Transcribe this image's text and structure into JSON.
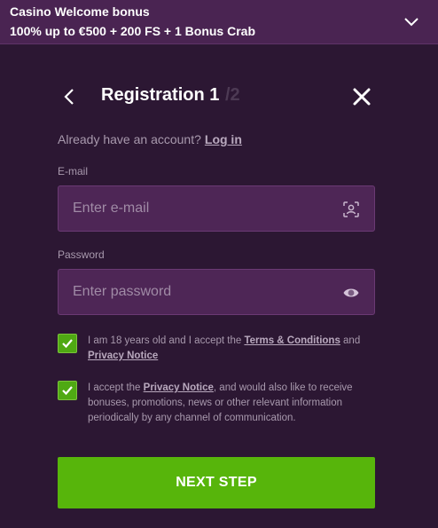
{
  "banner": {
    "title": "Casino Welcome bonus",
    "offer": "100% up to €500 + 200 FS + 1 Bonus Crab"
  },
  "header": {
    "title": "Registration 1",
    "step_total": "/2"
  },
  "account": {
    "prompt": "Already have an account?",
    "login_label": "Log in"
  },
  "email": {
    "label": "E-mail",
    "placeholder": "Enter e-mail",
    "value": ""
  },
  "password": {
    "label": "Password",
    "placeholder": "Enter password",
    "value": ""
  },
  "consent_terms": {
    "checked": true,
    "text_before": "I am 18 years old and I accept the ",
    "terms_link": "Terms & Conditions",
    "text_and": " and ",
    "privacy_link": "Privacy Notice"
  },
  "consent_marketing": {
    "checked": true,
    "text_before": "I accept the ",
    "privacy_link": "Privacy Notice",
    "text_after": ", and would also like to receive bonuses, promotions, news or other relevant information periodically by any channel of communication."
  },
  "next_button": {
    "label": "NEXT STEP"
  },
  "icons": {
    "banner_toggle": "chevron-down-icon",
    "back": "chevron-left-icon",
    "close": "close-icon",
    "email_field": "face-scan-icon",
    "password_field": "eye-icon",
    "checkbox_mark": "checkmark-icon"
  },
  "colors": {
    "background": "#2c1733",
    "banner": "#4a2452",
    "input_bg": "#4e2656",
    "accent_green": "#57b50b",
    "muted_text": "#a899ad"
  }
}
